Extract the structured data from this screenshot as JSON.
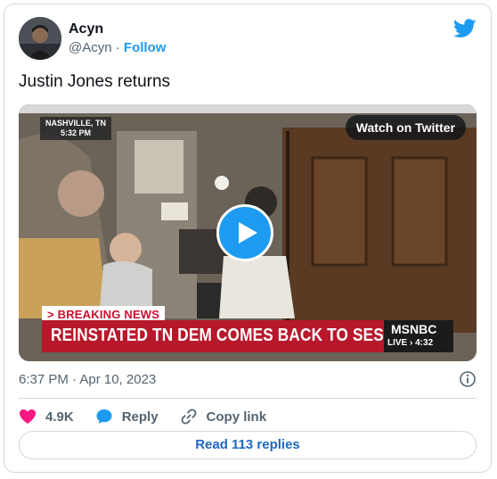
{
  "author": {
    "name": "Acyn",
    "handle": "@Acyn",
    "separator": "·",
    "follow_label": "Follow"
  },
  "tweet": {
    "text": "Justin Jones returns",
    "timestamp": "6:37 PM · Apr 10, 2023"
  },
  "media": {
    "watch_label": "Watch on Twitter",
    "location": "NASHVILLE, TN",
    "clock": "5:32 PM",
    "breaking": "> BREAKING NEWS",
    "headline": "REINSTATED TN DEM COMES BACK TO SESSION",
    "network": "MSNBC",
    "live": "LIVE › 4:32"
  },
  "actions": {
    "likes": "4.9K",
    "reply_label": "Reply",
    "copy_label": "Copy link"
  },
  "replies_button": "Read 113 replies",
  "colors": {
    "accent": "#1d9bf0",
    "like": "#f91880",
    "breaking_red": "#b8182b"
  },
  "icons": [
    "twitter-bird-icon",
    "play-icon",
    "info-icon",
    "heart-icon",
    "reply-bubble-icon",
    "link-icon"
  ]
}
